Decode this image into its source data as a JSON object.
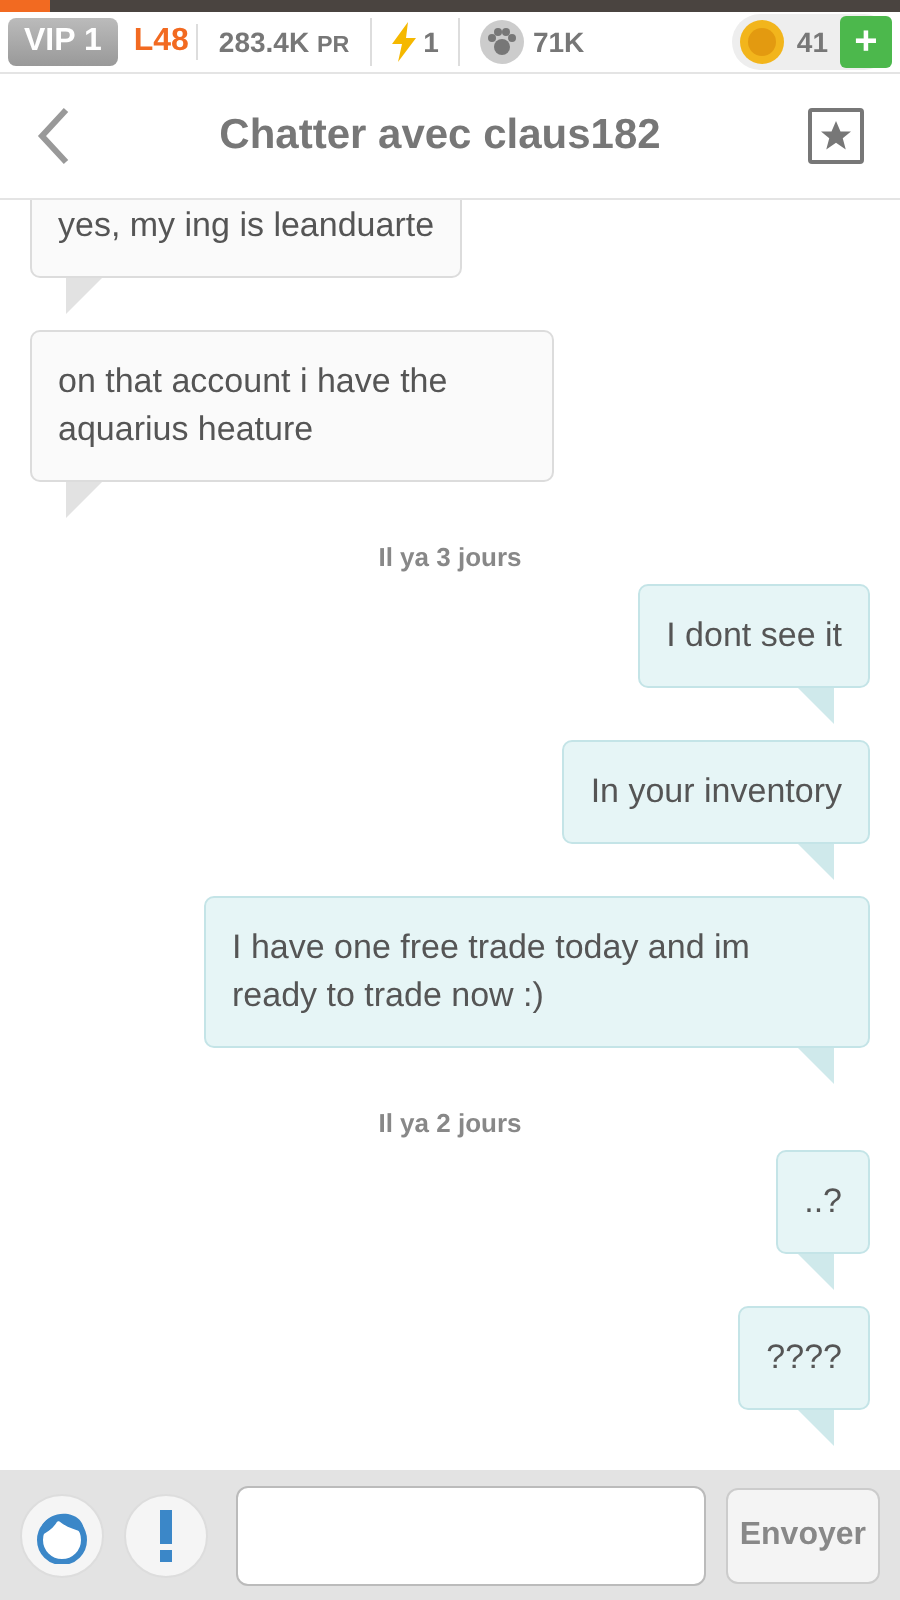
{
  "status_bar": {
    "xp": {
      "level": 0.055
    },
    "vip": "VIP 1",
    "level": "L48",
    "power": "283.4K",
    "power_unit": "PR",
    "energy": "1",
    "paws": "71K",
    "coins": "41",
    "add": "+"
  },
  "header": {
    "title": "Chatter avec claus182"
  },
  "messages": [
    {
      "kind": "received",
      "text": "yes, my ing is leanduarte"
    },
    {
      "kind": "received",
      "text": "on that account i have the aquarius heature"
    },
    {
      "kind": "time",
      "text": "Il ya 3 jours"
    },
    {
      "kind": "sent",
      "text": "I dont see it"
    },
    {
      "kind": "sent",
      "text": "In your inventory"
    },
    {
      "kind": "sent",
      "text": "I have one free trade today and im ready to trade now :)"
    },
    {
      "kind": "time",
      "text": "Il ya 2 jours"
    },
    {
      "kind": "sent",
      "text": "..?"
    },
    {
      "kind": "sent",
      "text": "????"
    }
  ],
  "composer": {
    "send": "Envoyer"
  }
}
